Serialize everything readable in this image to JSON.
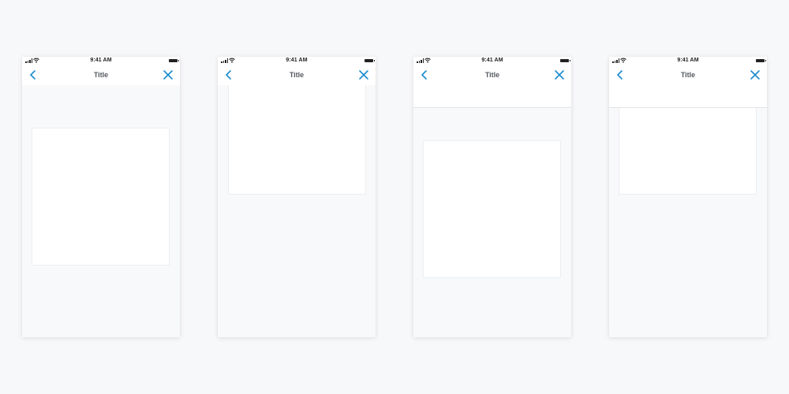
{
  "colors": {
    "background": "#f7f8fa",
    "screen": "#f7f9fb",
    "accent": "#1a8ccf",
    "title_text": "#555a60"
  },
  "status_bar": {
    "time": "9:41 AM",
    "icons": [
      "signal-icon",
      "wifi-icon",
      "battery-icon"
    ]
  },
  "screens": [
    {
      "title": "Title",
      "back_icon": "chevron-left-icon",
      "close_icon": "close-icon"
    },
    {
      "title": "Title",
      "back_icon": "chevron-left-icon",
      "close_icon": "close-icon"
    },
    {
      "title": "Title",
      "back_icon": "chevron-left-icon",
      "close_icon": "close-icon"
    },
    {
      "title": "Title",
      "back_icon": "chevron-left-icon",
      "close_icon": "close-icon"
    }
  ]
}
